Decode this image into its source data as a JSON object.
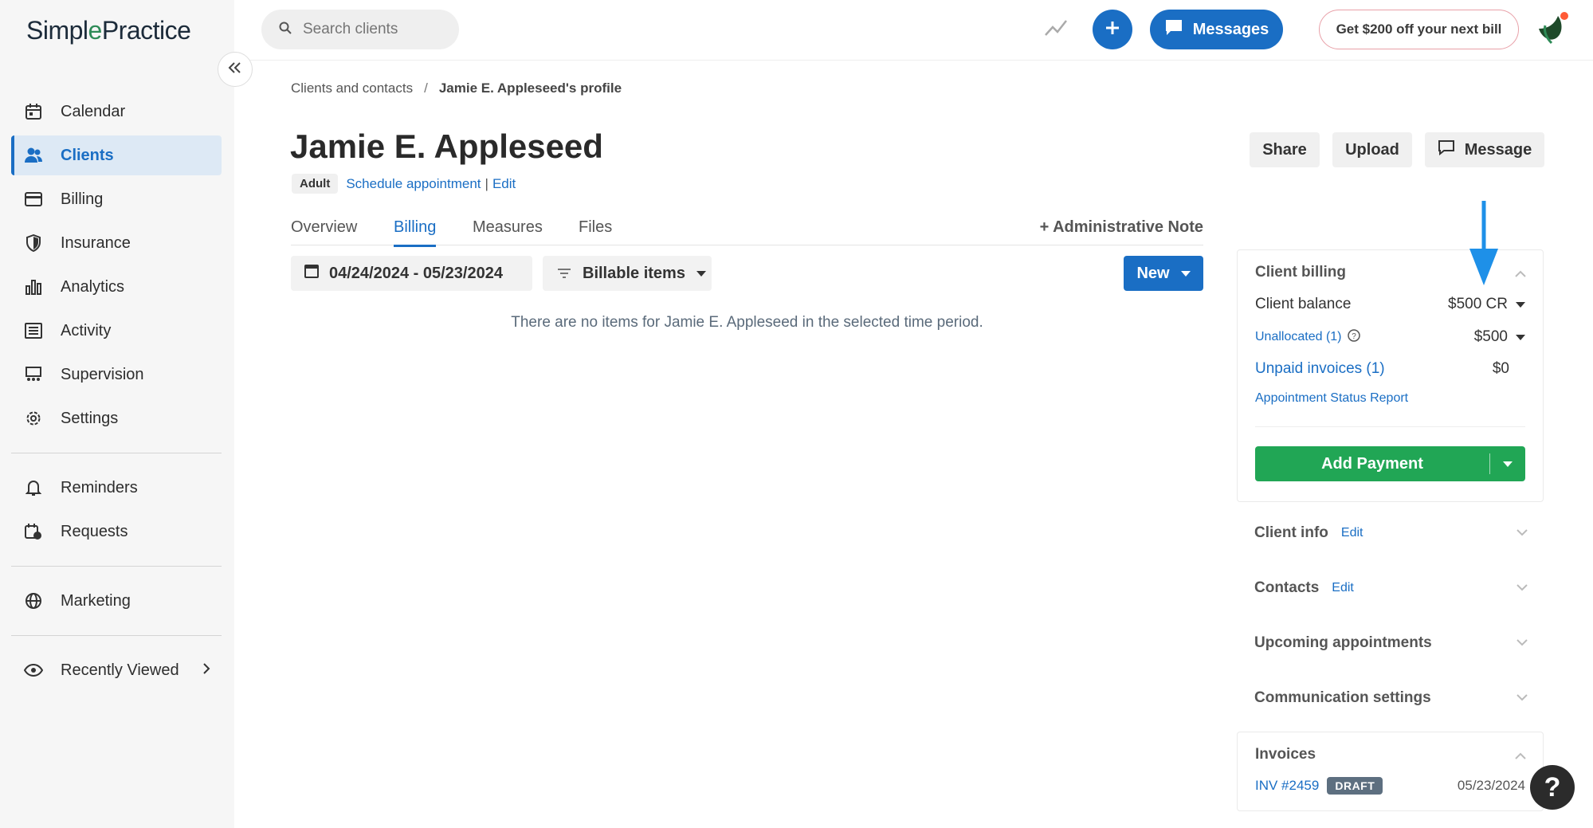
{
  "brand": {
    "name_part1": "Simpl",
    "name_leaf": "e",
    "name_part2": "Practice"
  },
  "search": {
    "placeholder": "Search clients"
  },
  "topbar": {
    "messages_label": "Messages",
    "promo_label": "Get $200 off your next bill"
  },
  "sidebar": {
    "items": [
      {
        "label": "Calendar",
        "icon": "calendar-icon"
      },
      {
        "label": "Clients",
        "icon": "clients-icon",
        "active": true
      },
      {
        "label": "Billing",
        "icon": "card-icon"
      },
      {
        "label": "Insurance",
        "icon": "shield-icon"
      },
      {
        "label": "Analytics",
        "icon": "bar-chart-icon"
      },
      {
        "label": "Activity",
        "icon": "list-icon"
      },
      {
        "label": "Supervision",
        "icon": "supervision-icon"
      },
      {
        "label": "Settings",
        "icon": "gear-icon"
      }
    ],
    "group2": [
      {
        "label": "Reminders",
        "icon": "bell-icon"
      },
      {
        "label": "Requests",
        "icon": "requests-icon"
      }
    ],
    "group3": [
      {
        "label": "Marketing",
        "icon": "globe-icon"
      }
    ],
    "group4": [
      {
        "label": "Recently Viewed",
        "icon": "eye-icon"
      }
    ]
  },
  "breadcrumb": {
    "parent": "Clients and contacts",
    "separator": "/",
    "current": "Jamie E. Appleseed's profile"
  },
  "client": {
    "name": "Jamie E. Appleseed",
    "tag": "Adult",
    "schedule_link": "Schedule appointment",
    "pipe": "|",
    "edit_link": "Edit"
  },
  "actions": {
    "share": "Share",
    "upload": "Upload",
    "message": "Message"
  },
  "tabs": [
    "Overview",
    "Billing",
    "Measures",
    "Files"
  ],
  "active_tab": "Billing",
  "admin_note": "+ Administrative Note",
  "filters": {
    "date_range": "04/24/2024 - 05/23/2024",
    "type": "Billable items",
    "new_label": "New"
  },
  "empty_message": "There are no items for Jamie E. Appleseed in the selected time period.",
  "client_billing": {
    "title": "Client billing",
    "balance_label": "Client balance",
    "balance_value": "$500 CR",
    "unallocated_label": "Unallocated (1)",
    "unallocated_value": "$500",
    "unpaid_label": "Unpaid invoices (1)",
    "unpaid_value": "$0",
    "report_link": "Appointment Status Report",
    "add_payment": "Add Payment"
  },
  "sections": {
    "client_info": {
      "title": "Client info",
      "edit": "Edit"
    },
    "contacts": {
      "title": "Contacts",
      "edit": "Edit"
    },
    "upcoming": {
      "title": "Upcoming appointments"
    },
    "communication": {
      "title": "Communication settings"
    }
  },
  "invoices": {
    "title": "Invoices",
    "number": "INV #2459",
    "status": "DRAFT",
    "date": "05/23/2024"
  },
  "help_label": "?",
  "colors": {
    "accent": "#1a6ec4",
    "success": "#21a655",
    "draft_badge": "#5d6f80"
  }
}
